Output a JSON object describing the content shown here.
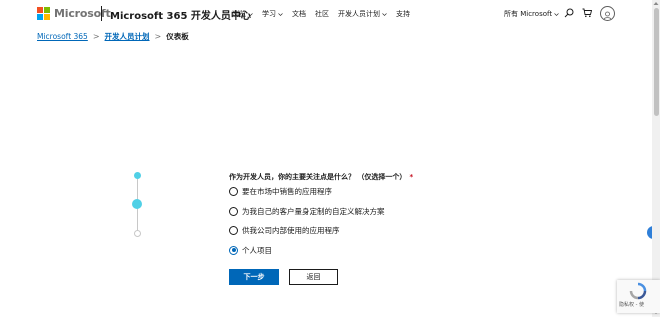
{
  "header": {
    "logo_text": "Microsoft",
    "site_title": "Microsoft 365 开发人员中心",
    "nav": [
      {
        "label": "浏览",
        "has_dropdown": true
      },
      {
        "label": "学习",
        "has_dropdown": true
      },
      {
        "label": "文档",
        "has_dropdown": false
      },
      {
        "label": "社区",
        "has_dropdown": false
      },
      {
        "label": "开发人员计划",
        "has_dropdown": true
      },
      {
        "label": "支持",
        "has_dropdown": false
      }
    ],
    "all_microsoft": "所有 Microsoft",
    "icons": [
      "search-icon",
      "cart-icon",
      "account-avatar"
    ]
  },
  "breadcrumb": {
    "items": [
      "Microsoft 365",
      "开发人员计划"
    ],
    "current": "仪表板"
  },
  "stepper": {
    "total_steps": 3,
    "active_step": 2
  },
  "form": {
    "question": "作为开发人员，你的主要关注点是什么？ （仅选择一个）",
    "required_mark": "*",
    "options": [
      {
        "label": "要在市场中销售的应用程序",
        "selected": false
      },
      {
        "label": "为我自己的客户量身定制的自定义解决方案",
        "selected": false
      },
      {
        "label": "供我公司内部使用的应用程序",
        "selected": false
      },
      {
        "label": "个人项目",
        "selected": true
      }
    ],
    "next_label": "下一步",
    "back_label": "返回"
  },
  "recaptcha": {
    "label": "隐私权 - 使"
  },
  "colors": {
    "accent": "#0067b8",
    "stepper_active": "#50d0e6",
    "logo_red": "#f25022",
    "logo_green": "#7fba00",
    "logo_blue": "#00a4ef",
    "logo_yellow": "#ffb900"
  }
}
